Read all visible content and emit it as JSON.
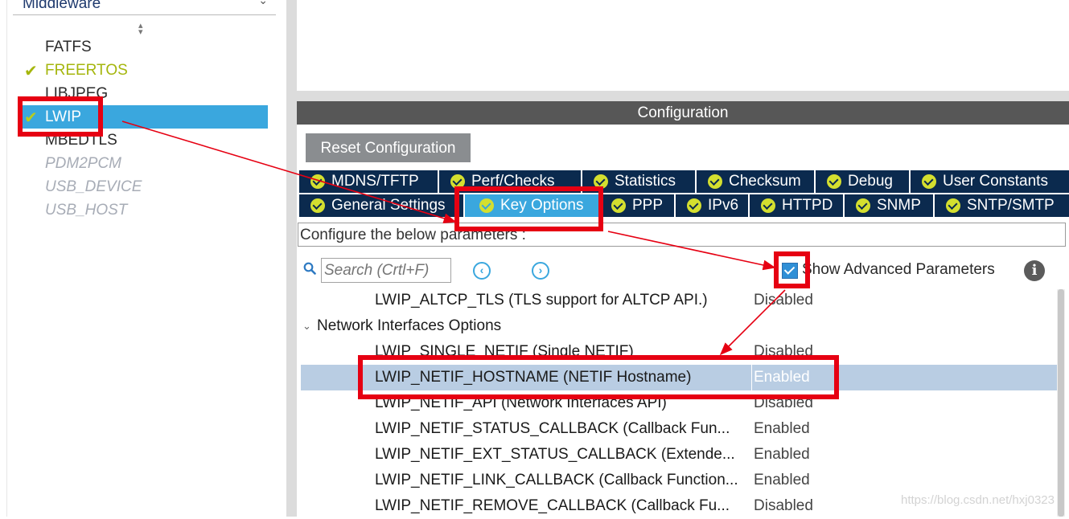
{
  "sidebar": {
    "category_header": "Middleware",
    "items": [
      {
        "label": "FATFS",
        "state": "enabled",
        "checked": false
      },
      {
        "label": "FREERTOS",
        "state": "active",
        "checked": true
      },
      {
        "label": "LIBJPEG",
        "state": "enabled",
        "checked": false
      },
      {
        "label": "LWIP",
        "state": "selected",
        "checked": true
      },
      {
        "label": "MBEDTLS",
        "state": "enabled",
        "checked": false
      },
      {
        "label": "PDM2PCM",
        "state": "disabled",
        "checked": false
      },
      {
        "label": "USB_DEVICE",
        "state": "disabled",
        "checked": false
      },
      {
        "label": "USB_HOST",
        "state": "disabled",
        "checked": false
      }
    ]
  },
  "config": {
    "header": "Configuration",
    "reset_label": "Reset Configuration",
    "tabs_row1": [
      "MDNS/TFTP",
      "Perf/Checks",
      "Statistics",
      "Checksum",
      "Debug",
      "User Constants"
    ],
    "tabs_row2": [
      "General Settings",
      "Key Options",
      "PPP",
      "IPv6",
      "HTTPD",
      "SNMP",
      "SNTP/SMTP"
    ],
    "selected_tab": "Key Options",
    "description": "Configure the below parameters :",
    "search_placeholder": "Search (Crtl+F)",
    "show_advanced_label": "Show Advanced Parameters",
    "show_advanced_checked": true,
    "params": {
      "top": {
        "name": "LWIP_ALTCP_TLS (TLS support for ALTCP API.)",
        "value": "Disabled"
      },
      "group": "Network Interfaces Options",
      "rows": [
        {
          "name": "LWIP_SINGLE_NETIF (Single NETIF)",
          "value": "Disabled",
          "selected": false
        },
        {
          "name": "LWIP_NETIF_HOSTNAME (NETIF Hostname)",
          "value": "Enabled",
          "selected": true
        },
        {
          "name": "LWIP_NETIF_API (Network Interfaces API)",
          "value": "Disabled",
          "selected": false
        },
        {
          "name": "LWIP_NETIF_STATUS_CALLBACK (Callback Fun...",
          "value": "Enabled",
          "selected": false
        },
        {
          "name": "LWIP_NETIF_EXT_STATUS_CALLBACK (Extende...",
          "value": "Enabled",
          "selected": false
        },
        {
          "name": "LWIP_NETIF_LINK_CALLBACK (Callback Function...",
          "value": "Enabled",
          "selected": false
        },
        {
          "name": "LWIP_NETIF_REMOVE_CALLBACK (Callback Fu...",
          "value": "Disabled",
          "selected": false
        }
      ]
    }
  },
  "watermark": "https://blog.csdn.net/hxj0323",
  "colors": {
    "selection_blue": "#3aa7de",
    "tab_navy": "#0b2a4e",
    "check_green": "#a5b60d",
    "annotation_red": "#e60012",
    "row_selected": "#b9cde3"
  }
}
